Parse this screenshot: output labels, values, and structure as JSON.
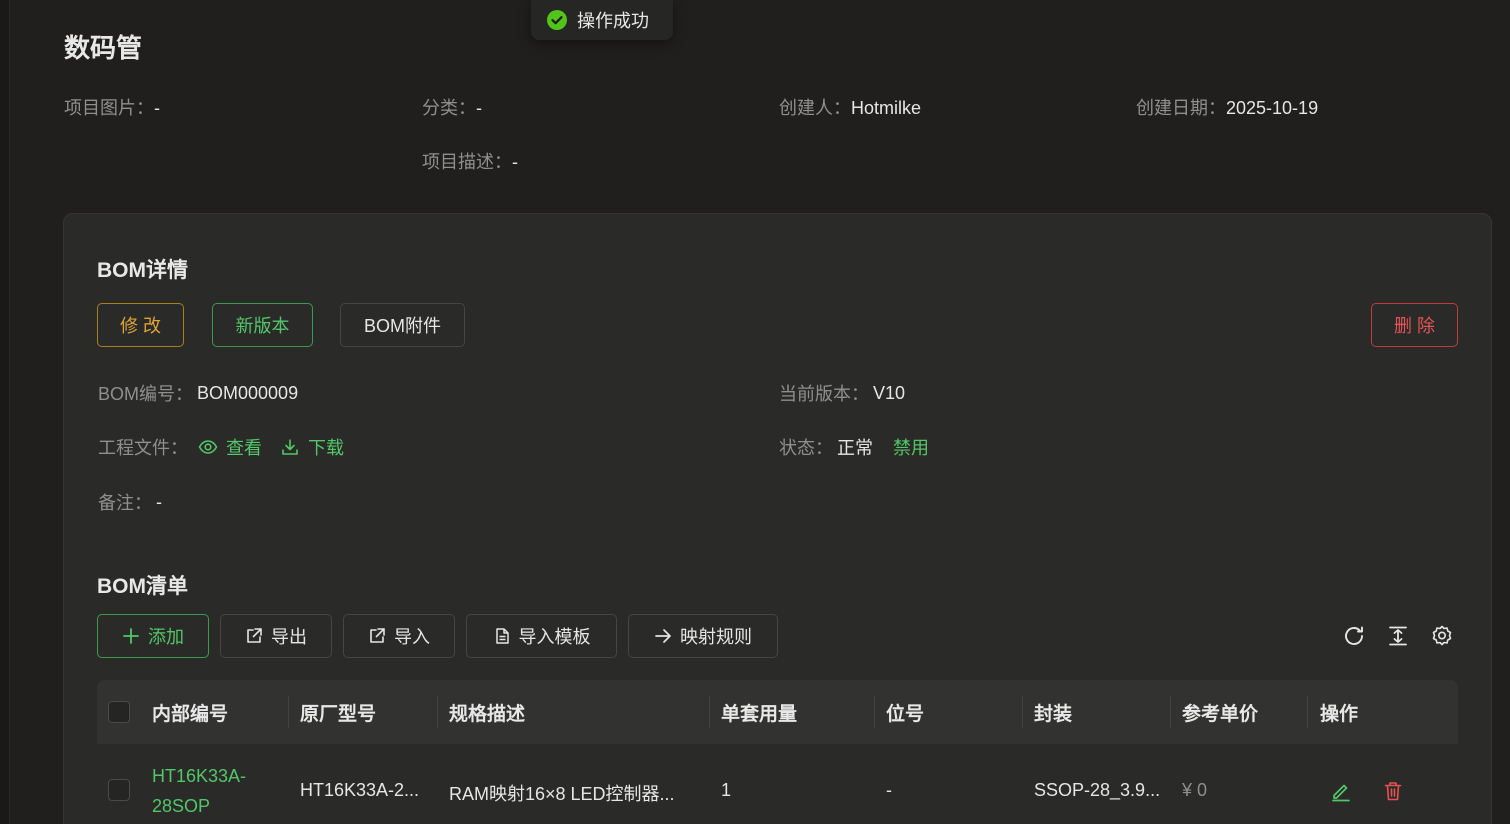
{
  "toast": {
    "text": "操作成功",
    "icon": "check-circle-icon",
    "color": "#52c41a"
  },
  "project": {
    "title": "数码管",
    "image_label": "项目图片：",
    "image_value": "-",
    "category_label": "分类：",
    "category_value": "-",
    "creator_label": "创建人：",
    "creator_value": "Hotmilke",
    "created_label": "创建日期：",
    "created_value": "2025-10-19",
    "desc_label": "项目描述：",
    "desc_value": "-"
  },
  "bom": {
    "section_title": "BOM详情",
    "buttons": {
      "edit": "修 改",
      "new_version": "新版本",
      "attachments": "BOM附件",
      "delete": "删 除"
    },
    "number_label": "BOM编号：",
    "number_value": "BOM000009",
    "version_label": "当前版本：",
    "version_value": "V10",
    "files_label": "工程文件：",
    "view_link": "查看",
    "download_link": "下载",
    "status_label": "状态：",
    "status_value": "正常",
    "disable_link": "禁用",
    "remark_label": "备注：",
    "remark_value": "-"
  },
  "bom_list": {
    "section_title": "BOM清单",
    "toolbar": {
      "add": "添加",
      "export": "导出",
      "import": "导入",
      "import_template": "导入模板",
      "mapping_rules": "映射规则"
    },
    "columns": [
      "内部编号",
      "原厂型号",
      "规格描述",
      "单套用量",
      "位号",
      "封装",
      "参考单价",
      "操作"
    ],
    "rows": [
      {
        "internal_no": "HT16K33A-28SOP",
        "mfr_part": "HT16K33A-2...",
        "spec": "RAM映射16×8 LED控制器...",
        "qty": "1",
        "ref": "-",
        "package": "SSOP-28_3.9...",
        "price": "¥ 0"
      }
    ]
  },
  "colors": {
    "accent_green": "#52c767",
    "warning": "#e0a437",
    "danger": "#e65353",
    "background": "#201f1d",
    "card": "#2a2a29"
  }
}
